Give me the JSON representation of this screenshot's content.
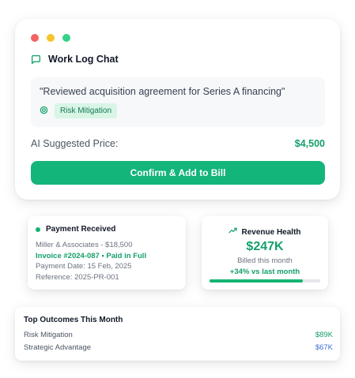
{
  "window": {
    "dot_colors": [
      "#f26464",
      "#f5c52b",
      "#36d188"
    ]
  },
  "chat": {
    "title": "Work Log Chat",
    "icon": "chat-bubble-icon",
    "quote": "\"Reviewed acquisition agreement for Series A financing\"",
    "tag_icon": "target-icon",
    "tag": "Risk Mitigation",
    "price_label": "AI Suggested Price:",
    "price_value": "$4,500",
    "confirm_label": "Confirm & Add to Bill"
  },
  "payment": {
    "title": "Payment Received",
    "status_color": "#14b472",
    "client": "Miller & Associates - $18,500",
    "invoice": "Invoice #2024-087 • Paid in Full",
    "date": "Payment Date: 15 Feb, 2025",
    "reference": "Reference: 2025-PR-001"
  },
  "revenue": {
    "title": "Revenue Health",
    "icon": "trending-up-icon",
    "value": "$247K",
    "subtitle": "Billed this month",
    "change": "+34% vs last month",
    "progress": 0.84
  },
  "outcomes": {
    "title": "Top Outcomes This Month",
    "items": [
      {
        "label": "Risk Mitigation",
        "value": "$89K",
        "color": "#14a06a"
      },
      {
        "label": "Strategic Advantage",
        "value": "$67K",
        "color": "#3b6fd8"
      }
    ]
  },
  "colors": {
    "accent": "#13b57a",
    "accent_text": "#14a06a",
    "tag_bg": "#d8f5e6"
  }
}
